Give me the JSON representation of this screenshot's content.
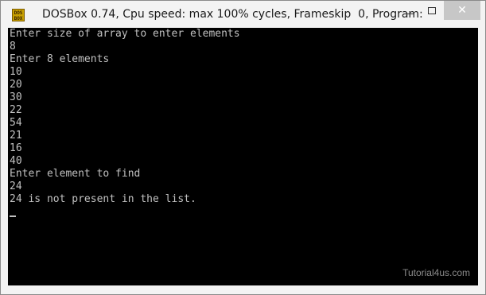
{
  "window": {
    "title": "DOSBox 0.74, Cpu speed: max 100% cycles, Frameskip  0, Program:",
    "icon_text": "DOS BOX",
    "icon": "dosbox-icon"
  },
  "console": {
    "lines": [
      "Enter size of array to enter elements",
      "8",
      "Enter 8 elements",
      "10",
      "20",
      "30",
      "22",
      "54",
      "21",
      "16",
      "40",
      "Enter element to find",
      "24",
      "24 is not present in the list."
    ],
    "text_color": "#c0c0c0",
    "background": "#000000"
  },
  "watermark": "Tutorial4us.com"
}
